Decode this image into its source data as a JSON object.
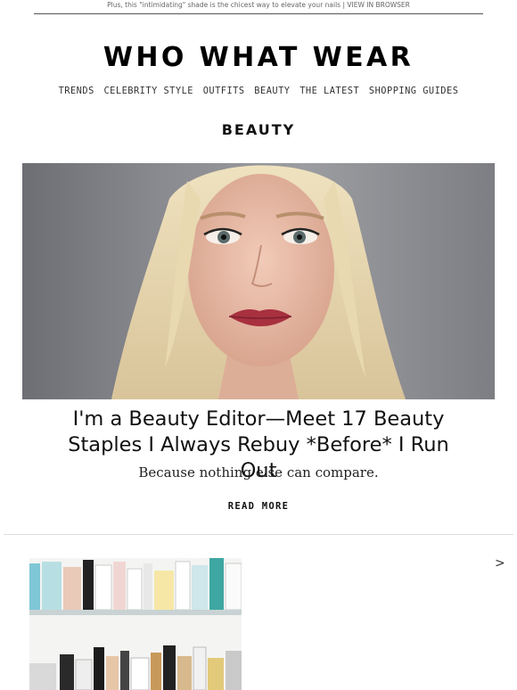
{
  "preheader": {
    "text": "Plus, this \"intimidating\" shade is the chicest way to elevate your nails |",
    "view_link": "VIEW IN BROWSER"
  },
  "logo": "WHO WHAT WEAR",
  "nav": {
    "items": [
      "TRENDS",
      "CELEBRITY STYLE",
      "OUTFITS",
      "BEAUTY",
      "THE LATEST",
      "SHOPPING GUIDES"
    ]
  },
  "section": {
    "title": "BEAUTY"
  },
  "article": {
    "headline_line1": "I'm a Beauty Editor—Meet 17 Beauty",
    "headline_line2": "Staples I Always Rebuy *Before* I Run Out",
    "dek": "Because nothing else can compare.",
    "cta": "READ MORE"
  },
  "next_item": {
    "arrow": ">"
  },
  "colors": {
    "text": "#111111",
    "rule": "#555555",
    "divider": "#dddddd"
  }
}
